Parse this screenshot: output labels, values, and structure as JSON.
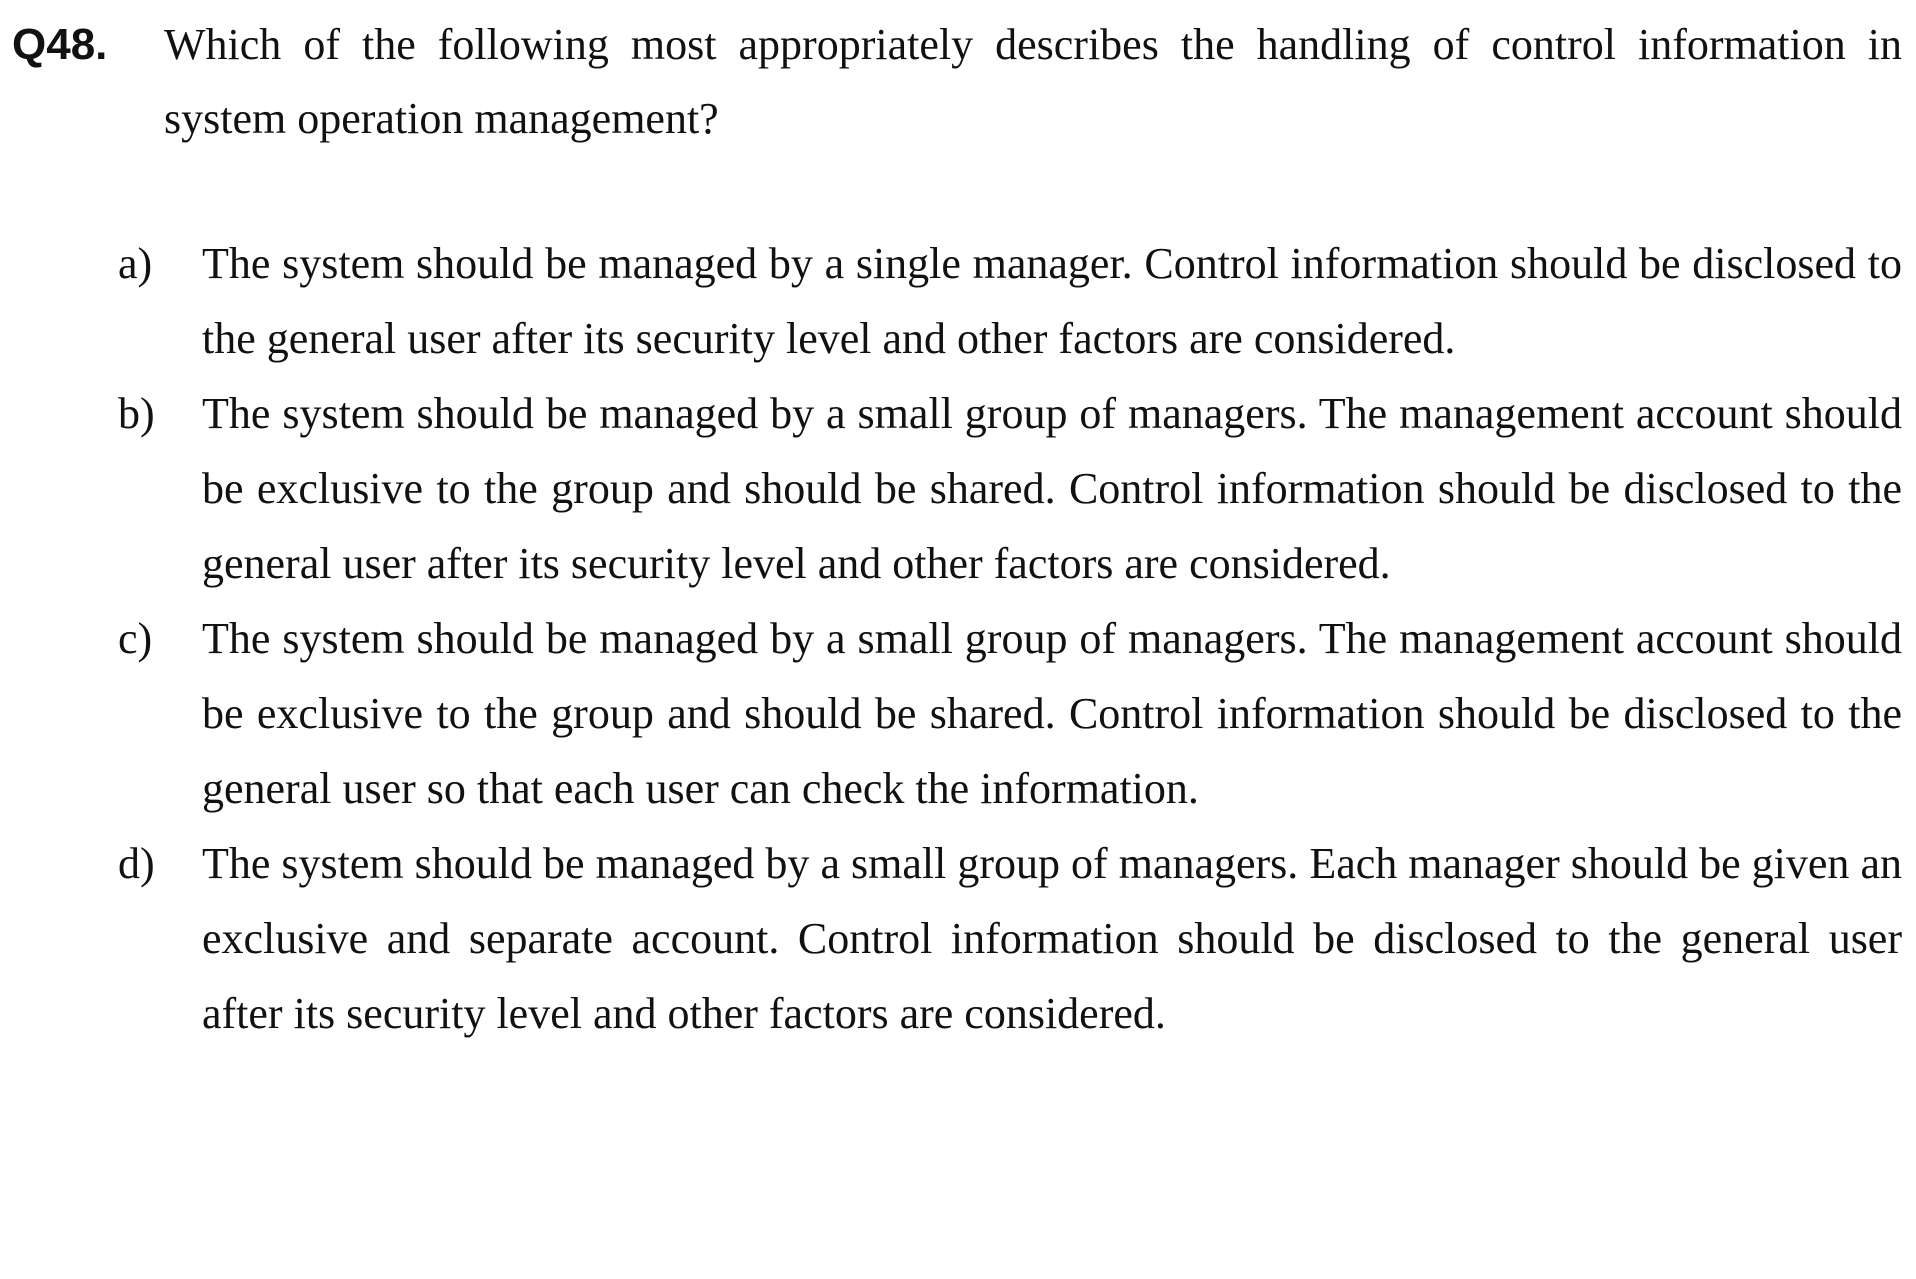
{
  "question": {
    "number": "Q48.",
    "text": "Which of the following most appropriately describes the handling of control information in system operation management?"
  },
  "options": [
    {
      "letter": "a)",
      "text": "The system should be managed by a single manager.   Control information should be disclosed to the general user after its security level and other factors are considered."
    },
    {
      "letter": "b)",
      "text": "The system should be managed by a small group of managers.   The management account should be exclusive to the group and should be shared.   Control information should be disclosed to the general user after its security level and other factors are considered."
    },
    {
      "letter": "c)",
      "text": "The system should be managed by a small group of managers.   The management account should be exclusive to the group and should be shared.   Control information should be disclosed to the general user so that each user can check the information."
    },
    {
      "letter": "d)",
      "text": "The system should be managed by a small group of managers.   Each manager should be given an exclusive and separate account. Control information should be disclosed to the general user after its security level and other factors are considered."
    }
  ]
}
